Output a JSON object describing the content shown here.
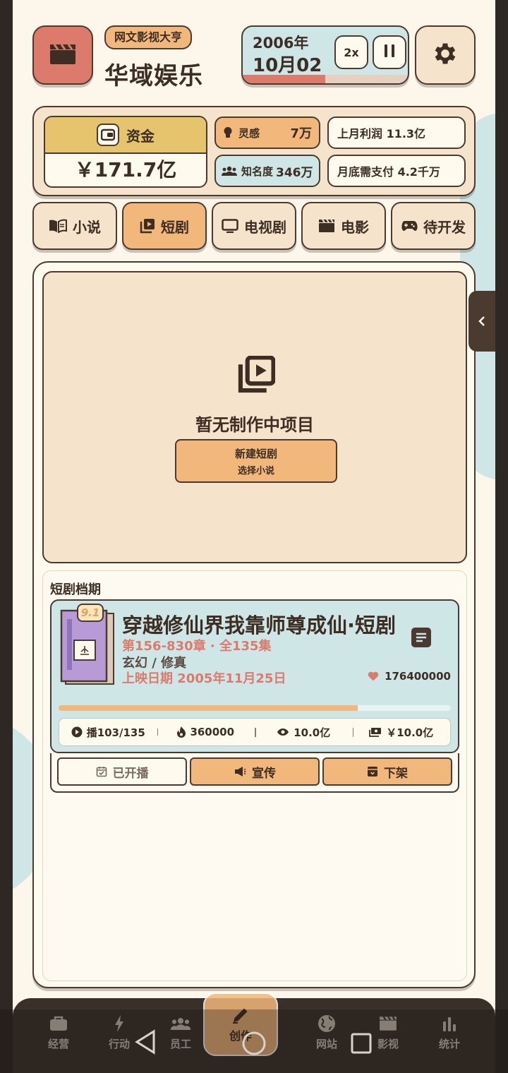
{
  "header": {
    "tagline": "网文影视大亨",
    "company": "华域娱乐",
    "date_year": "2006年",
    "date_day": "10月02",
    "speed": "2x",
    "month_progress": 0.5
  },
  "stats": {
    "fund_label": "资金",
    "fund_value": "￥171.7亿",
    "inspiration_label": "灵感",
    "inspiration_value": "7万",
    "fame_label": "知名度",
    "fame_value": "346万",
    "profit_text": "上月利润 11.3亿",
    "payment_text": "月底需支付 4.2千万"
  },
  "tabs": [
    {
      "label": "小说",
      "icon": "book-icon"
    },
    {
      "label": "短剧",
      "icon": "video-library-icon",
      "active": true
    },
    {
      "label": "电视剧",
      "icon": "tv-icon"
    },
    {
      "label": "电影",
      "icon": "clapperboard-icon"
    },
    {
      "label": "待开发",
      "icon": "gamepad-icon"
    }
  ],
  "empty": {
    "text": "暂无制作中项目",
    "button_line1": "新建短剧",
    "button_line2": "选择小说"
  },
  "schedule": {
    "title": "短剧档期",
    "item": {
      "rating": "9.1",
      "title": "穿越修仙界我靠师尊成仙·短剧",
      "chapters": "第156-830章 · 全135集",
      "genre": "玄幻 / 修真",
      "release": "上映日期 2005年11月25日",
      "likes": "176400000",
      "progress": 0.763,
      "metrics": {
        "episodes": "播103/135",
        "heat": "360000",
        "views": "10.0亿",
        "revenue": "￥10.0亿"
      }
    },
    "actions": {
      "aired": "已开播",
      "promote": "宣传",
      "remove": "下架"
    }
  },
  "nav": {
    "business": "经营",
    "action": "行动",
    "staff": "员工",
    "create": "创作",
    "website": "网站",
    "film": "影视",
    "stats": "统计"
  },
  "colors": {
    "background": "#fdf6ea",
    "accent_orange": "#f2b77a",
    "accent_red": "#dc7b6c",
    "accent_teal": "#cfe6e6",
    "beige": "#f6e3cb",
    "gold": "#e6c46d",
    "dark": "#4b3a30"
  }
}
